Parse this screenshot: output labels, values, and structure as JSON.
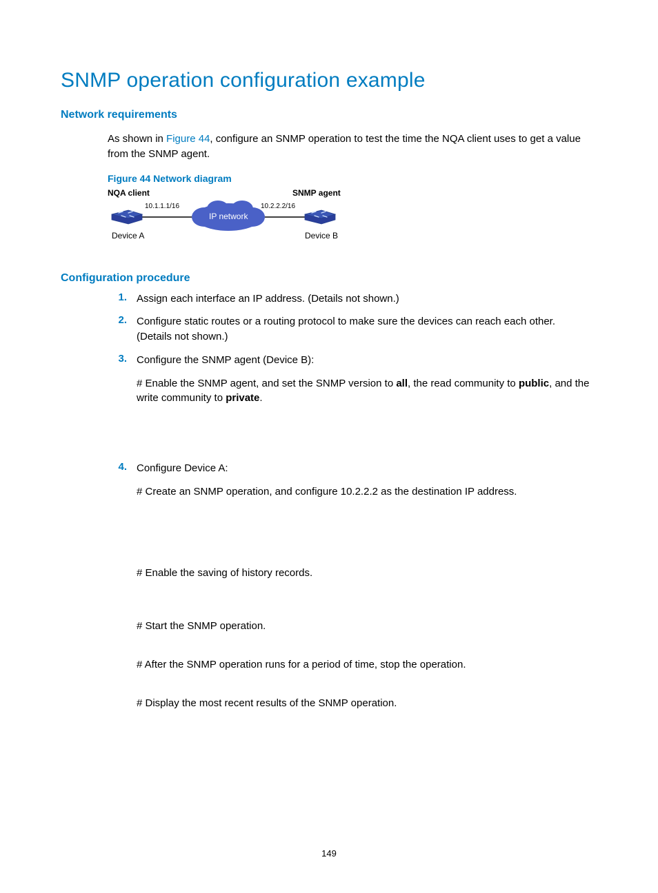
{
  "title": "SNMP operation configuration example",
  "sub1": "Network requirements",
  "intro_pre": "As shown in ",
  "intro_link": "Figure 44",
  "intro_post": ", configure an SNMP operation to test the time the NQA client uses to get a value from the SNMP agent.",
  "figcap": "Figure 44 Network diagram",
  "diagram": {
    "nqa_client": "NQA client",
    "snmp_agent": "SNMP agent",
    "ip_network": "IP network",
    "device_a": "Device A",
    "device_b": "Device B",
    "ip_a": "10.1.1.1/16",
    "ip_b": "10.2.2.2/16"
  },
  "sub2": "Configuration procedure",
  "steps": {
    "s1_num": "1.",
    "s1_txt": "Assign each interface an IP address. (Details not shown.)",
    "s2_num": "2.",
    "s2_txt": "Configure static routes or a routing protocol to make sure the devices can reach each other. (Details not shown.)",
    "s3_num": "3.",
    "s3_txt": "Configure the SNMP agent (Device B):",
    "s3_sub_pre": "# Enable the SNMP agent, and set the SNMP version to ",
    "s3_sub_b1": "all",
    "s3_sub_mid1": ", the read community to ",
    "s3_sub_b2": "public",
    "s3_sub_mid2": ", and the write community to ",
    "s3_sub_b3": "private",
    "s3_sub_end": ".",
    "s4_num": "4.",
    "s4_txt": "Configure Device A:",
    "s4_a": "# Create an SNMP operation, and configure 10.2.2.2 as the destination IP address.",
    "s4_b": "# Enable the saving of history records.",
    "s4_c": "# Start the SNMP operation.",
    "s4_d": "# After the SNMP operation runs for a period of time, stop the operation.",
    "s4_e": "# Display the most recent results of the SNMP operation."
  },
  "page_num": "149"
}
